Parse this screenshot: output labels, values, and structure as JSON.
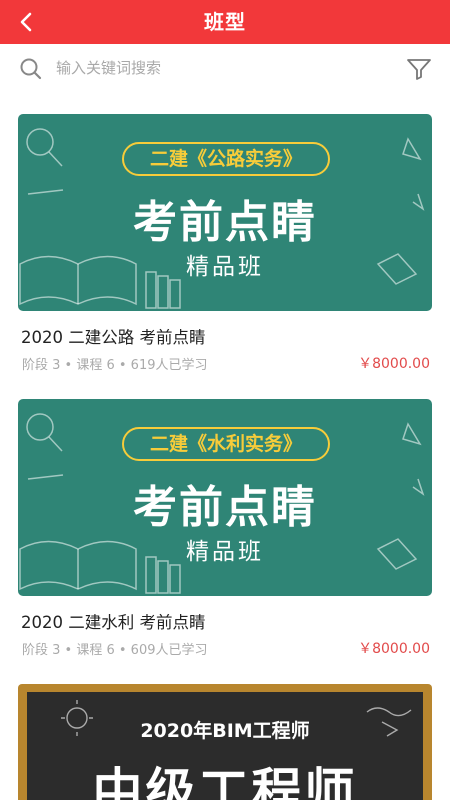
{
  "header": {
    "title": "班型",
    "back_icon": "chevron-left-icon",
    "background": "#f2383a"
  },
  "search": {
    "placeholder": "输入关键词搜索",
    "value": "",
    "search_icon": "search-icon",
    "filter_icon": "filter-icon"
  },
  "courses": [
    {
      "banner": {
        "tag": "二建《公路实务》",
        "main": "考前点睛",
        "sub": "精品班"
      },
      "title": "2020  二建公路  考前点睛",
      "meta": "阶段 3 • 课程 6 • 619人已学习",
      "price": "￥8000.00"
    },
    {
      "banner": {
        "tag": "二建《水利实务》",
        "main": "考前点睛",
        "sub": "精品班"
      },
      "title": "2020  二建水利  考前点睛",
      "meta": "阶段 3 • 课程 6 • 609人已学习",
      "price": "￥8000.00"
    },
    {
      "banner": {
        "line1": "2020年BIM工程师",
        "line2": "中级工程师"
      }
    }
  ],
  "colors": {
    "accent": "#f2383a",
    "price": "#e24b4b",
    "banner_green": "#2f8576",
    "tag_yellow": "#f7cc3a"
  }
}
